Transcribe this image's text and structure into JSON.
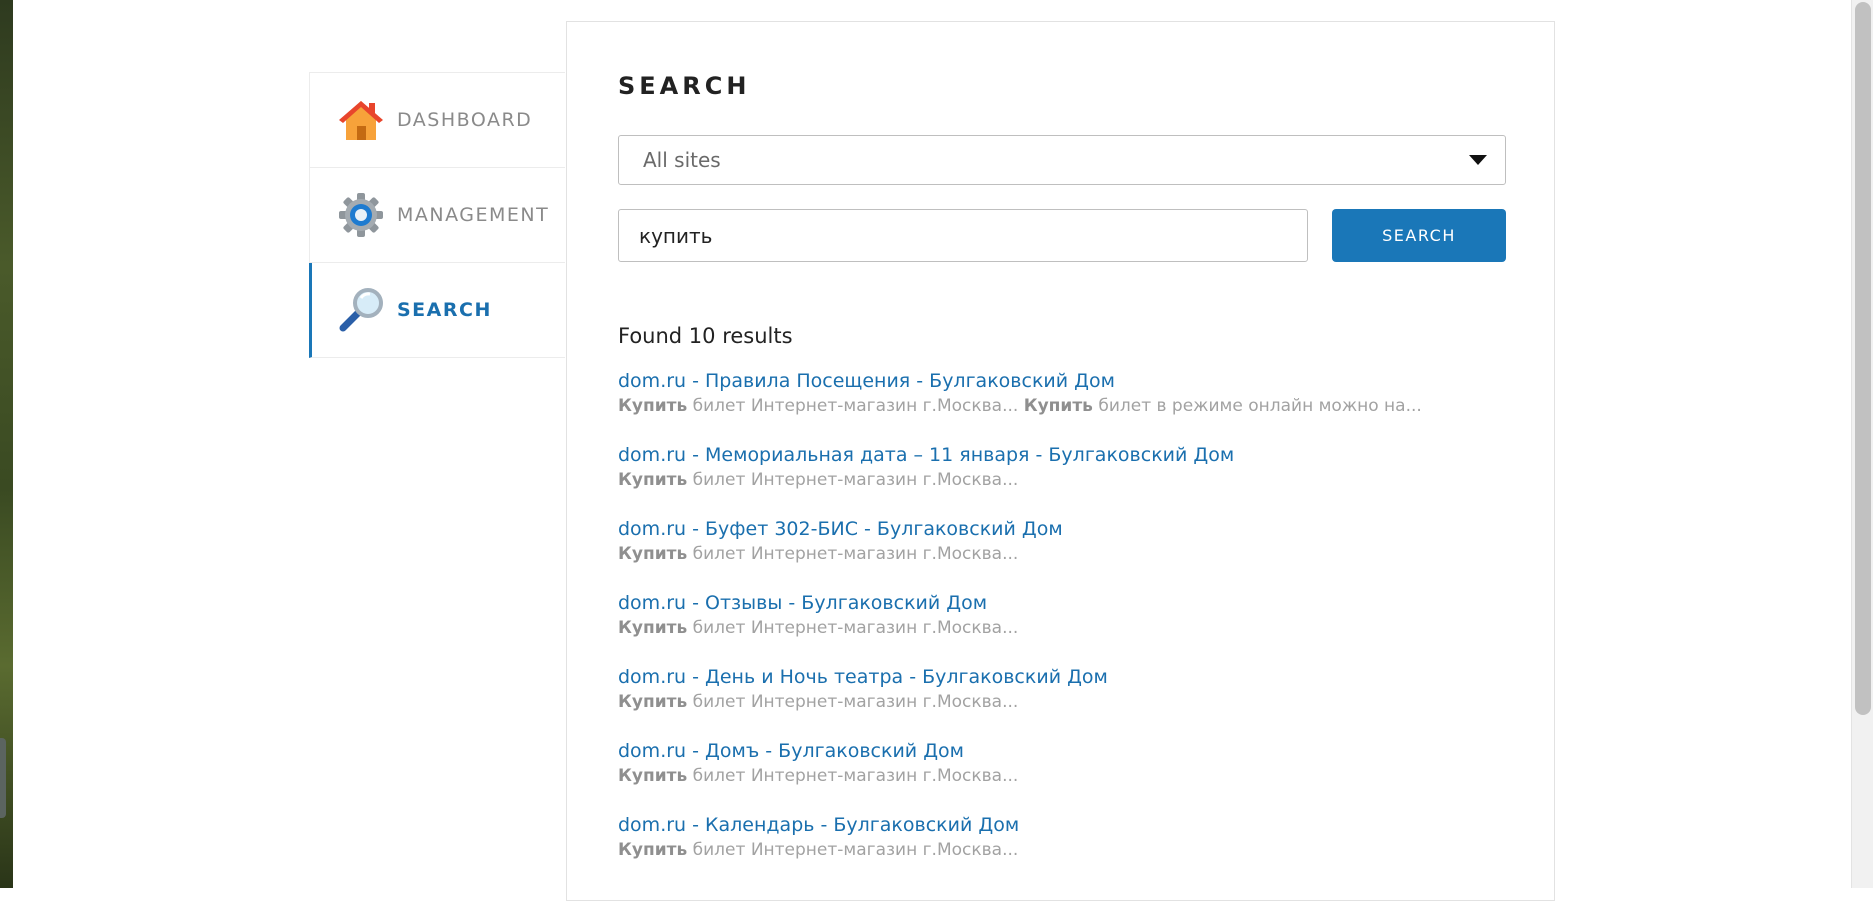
{
  "sidebar": {
    "items": [
      {
        "label": "DASHBOARD",
        "icon": "house-icon",
        "active": false
      },
      {
        "label": "MANAGEMENT",
        "icon": "gear-icon",
        "active": false
      },
      {
        "label": "SEARCH",
        "icon": "magnifier-icon",
        "active": true
      }
    ]
  },
  "main": {
    "title": "SEARCH",
    "site_select": {
      "value": "All sites"
    },
    "search": {
      "value": "купить"
    },
    "search_button": "SEARCH",
    "results_count_text": "Found 10 results",
    "results": [
      {
        "title": "dom.ru - Правила Посещения - Булгаковский Дом",
        "snippet": {
          "hl1": "Купить",
          "t1": " билет Интернет-магазин г.Москва... ",
          "hl2": "Купить",
          "t2": " билет в режиме онлайн можно на..."
        }
      },
      {
        "title": "dom.ru - Мемориальная дата – 11 января - Булгаковский Дом",
        "snippet": {
          "hl1": "Купить",
          "t1": " билет Интернет-магазин г.Москва..."
        }
      },
      {
        "title": "dom.ru - Буфет 302-БИС - Булгаковский Дом",
        "snippet": {
          "hl1": "Купить",
          "t1": " билет Интернет-магазин г.Москва..."
        }
      },
      {
        "title": "dom.ru - Отзывы - Булгаковский Дом",
        "snippet": {
          "hl1": "Купить",
          "t1": " билет Интернет-магазин г.Москва..."
        }
      },
      {
        "title": "dom.ru - День и Ночь театра - Булгаковский Дом",
        "snippet": {
          "hl1": "Купить",
          "t1": " билет Интернет-магазин г.Москва..."
        }
      },
      {
        "title": "dom.ru - Домъ - Булгаковский Дом",
        "snippet": {
          "hl1": "Купить",
          "t1": " билет Интернет-магазин г.Москва..."
        }
      },
      {
        "title": "dom.ru - Календарь - Булгаковский Дом",
        "snippet": {
          "hl1": "Купить",
          "t1": " билет Интернет-магазин г.Москва..."
        }
      }
    ]
  },
  "colors": {
    "accent": "#1a77b8",
    "link": "#1a6fae",
    "muted_text": "#a2a2a2",
    "nav_text": "#8a8a8a"
  }
}
